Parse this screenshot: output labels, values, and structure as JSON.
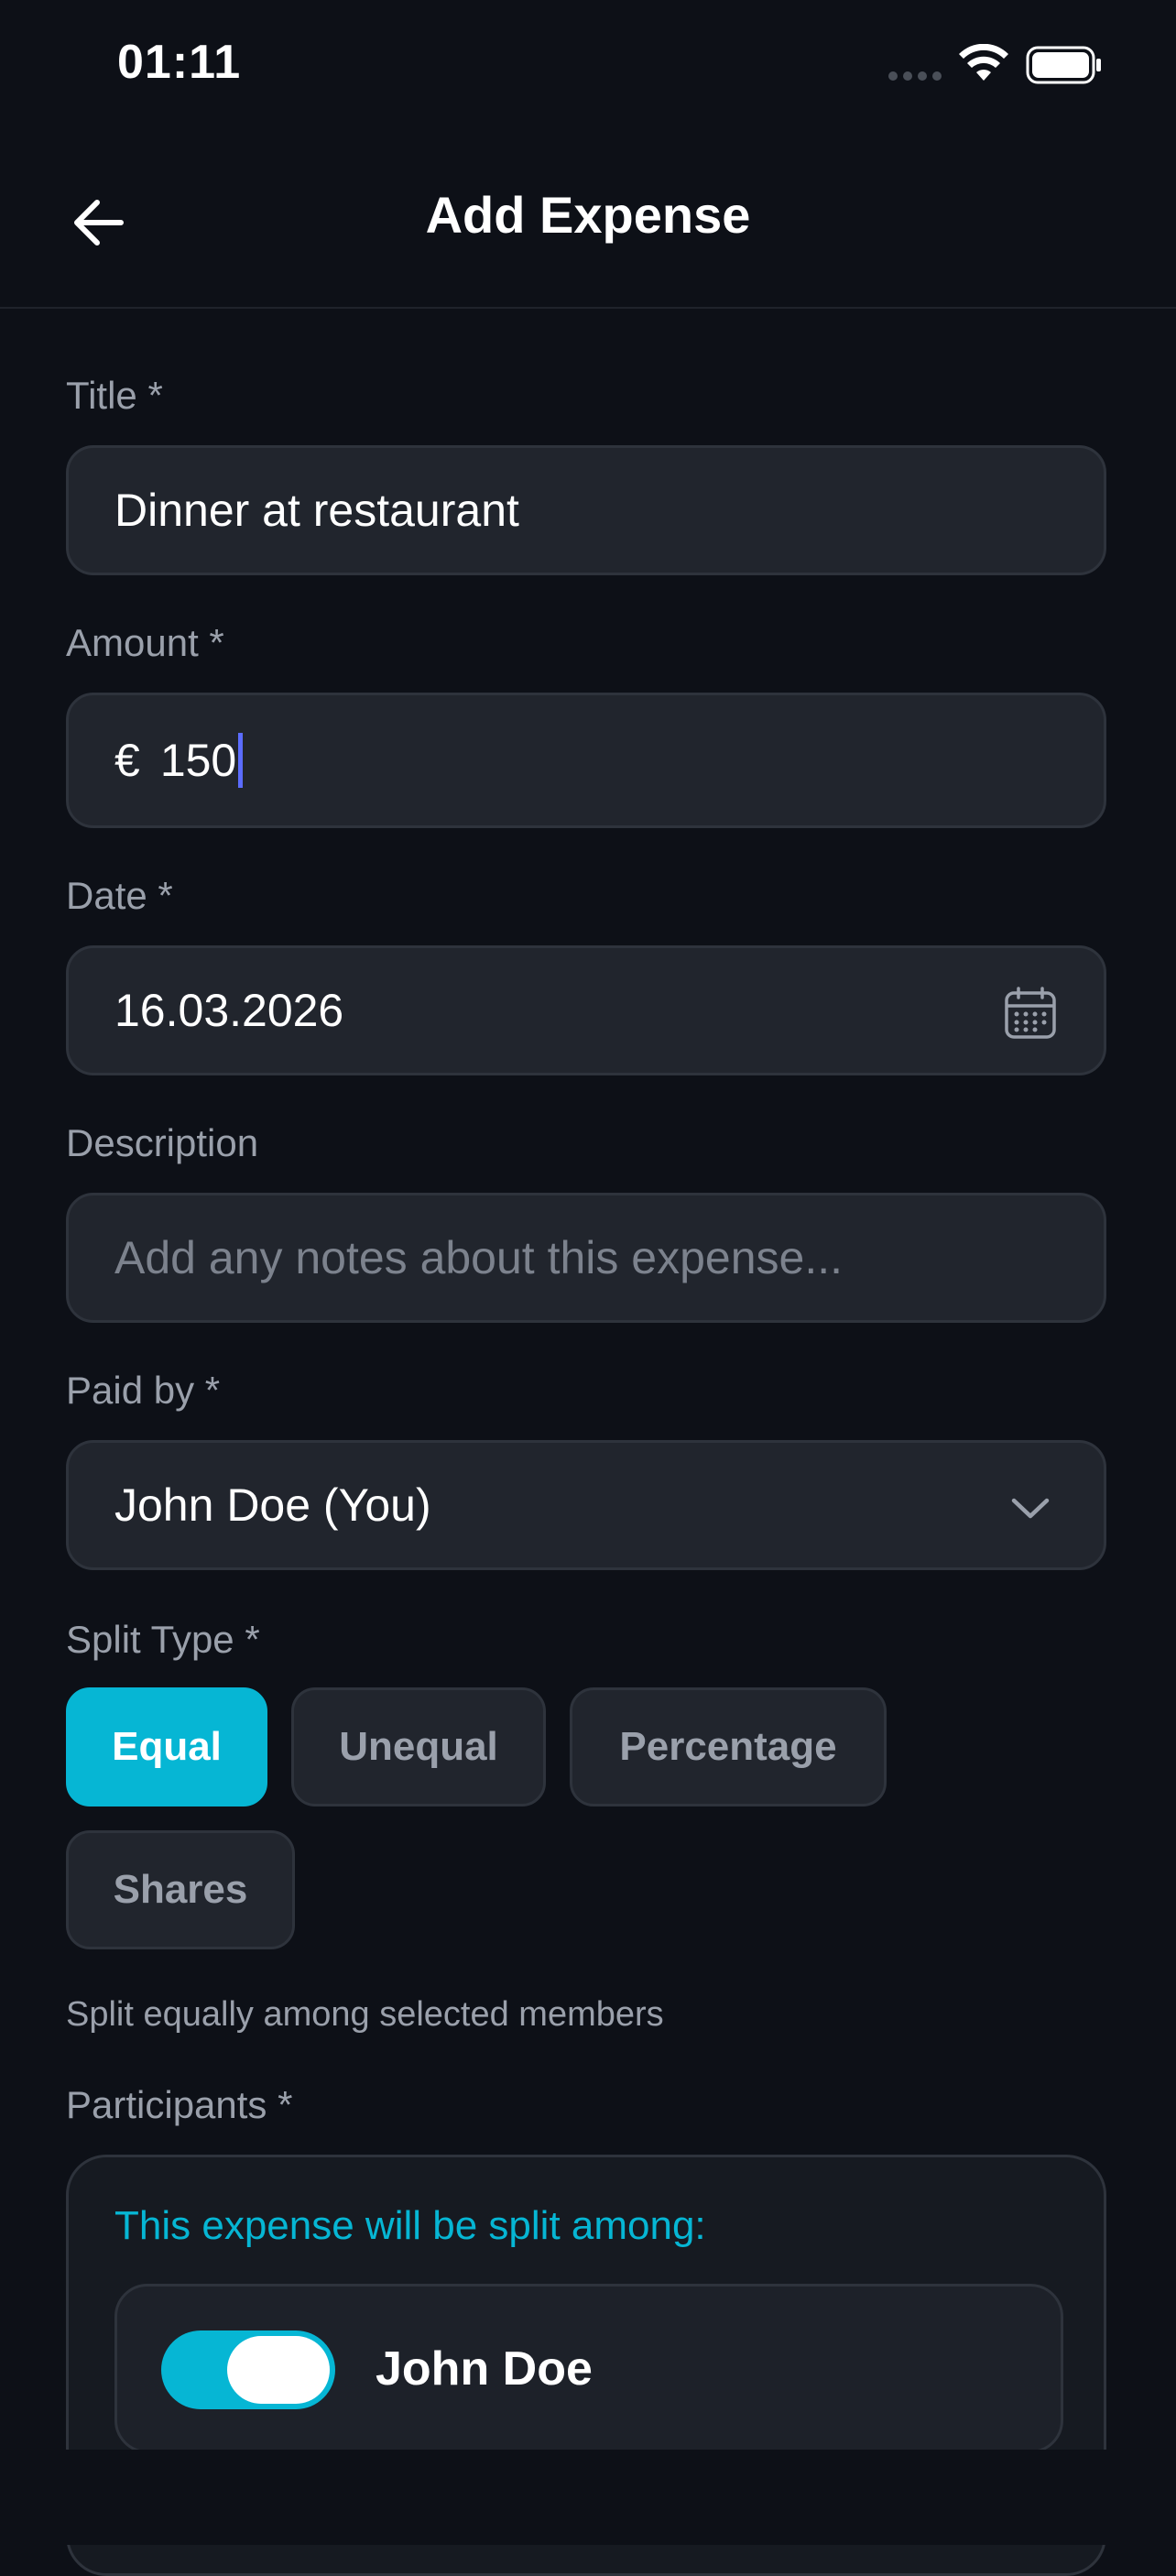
{
  "status_bar": {
    "time": "01:11"
  },
  "header": {
    "title": "Add Expense"
  },
  "form": {
    "title": {
      "label": "Title *",
      "value": "Dinner at restaurant"
    },
    "amount": {
      "label": "Amount *",
      "currency": "€",
      "value": "150"
    },
    "date": {
      "label": "Date *",
      "value": "16.03.2026"
    },
    "description": {
      "label": "Description",
      "placeholder": "Add any notes about this expense..."
    },
    "paid_by": {
      "label": "Paid by *",
      "value": "John Doe (You)"
    },
    "split_type": {
      "label": "Split Type *",
      "options": [
        "Equal",
        "Unequal",
        "Percentage",
        "Shares"
      ],
      "selected": "Equal",
      "helper": "Split equally among selected members"
    },
    "participants": {
      "label": "Participants *",
      "note": "This expense will be split among:",
      "members": [
        {
          "name": "John Doe",
          "included": true
        }
      ]
    }
  },
  "colors": {
    "accent": "#06b6d4",
    "background": "#0d1017",
    "field": "#21252d",
    "caret": "#5b6cff"
  },
  "icons": [
    "back-arrow-icon",
    "calendar-icon",
    "chevron-down-icon",
    "wifi-icon",
    "battery-icon",
    "signal-icon"
  ]
}
